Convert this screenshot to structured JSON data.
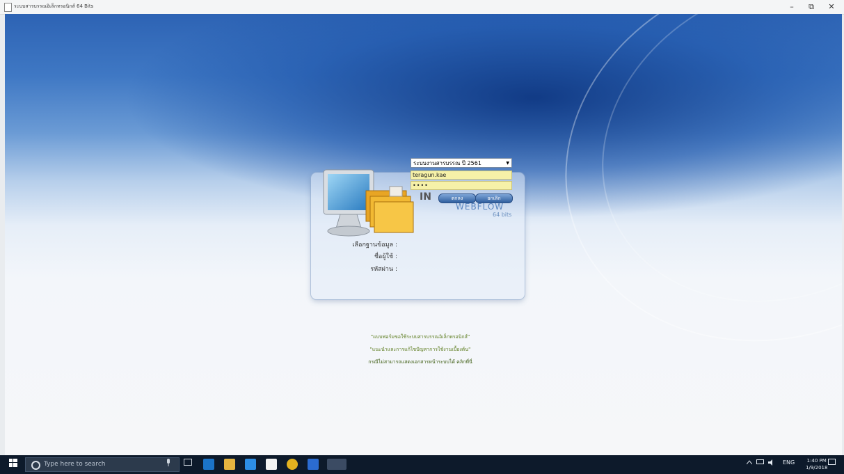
{
  "window": {
    "title": "ระบบสารบรรณอิเล็กทรอนิกส์ 64 Bits",
    "minimize_glyph": "–",
    "maximize_glyph": "⧉",
    "close_glyph": "✕"
  },
  "login": {
    "database_selected": "ระบบงานสารบรรณ ปี 2561",
    "database_arrow": "▼",
    "username_value": "teragun.kae",
    "password_value": "••••",
    "ok_button": "ตกลง",
    "cancel_button": "ยกเลิก",
    "brand_prefix": "IN",
    "brand_name": "WEBFLOW",
    "brand_bits": "64 bits",
    "label_database": "เลือกฐานข้อมูล :",
    "label_username": "ชื่อผู้ใช้ :",
    "label_password": "รหัสผ่าน :"
  },
  "links": [
    "\"แบบฟอร์มขอใช้ระบบสารบรรณอิเล็กทรอนิกส์\"",
    "\"แนะนำและการแก้ไขปัญหาการใช้งานเบื้องต้น\"",
    "กรณีไม่สามารถแสดงเอกสารหน้าระบบได้ คลิกที่นี่"
  ],
  "taskbar": {
    "search_placeholder": "Type here to search",
    "language": "ENG",
    "time": "1:40 PM",
    "date": "1/9/2018"
  },
  "colors": {
    "accent_blue": "#2d63b4",
    "taskbar": "#0d1a2b",
    "field_yellow": "#f6f1a8",
    "link_green": "#5a7a1c"
  }
}
